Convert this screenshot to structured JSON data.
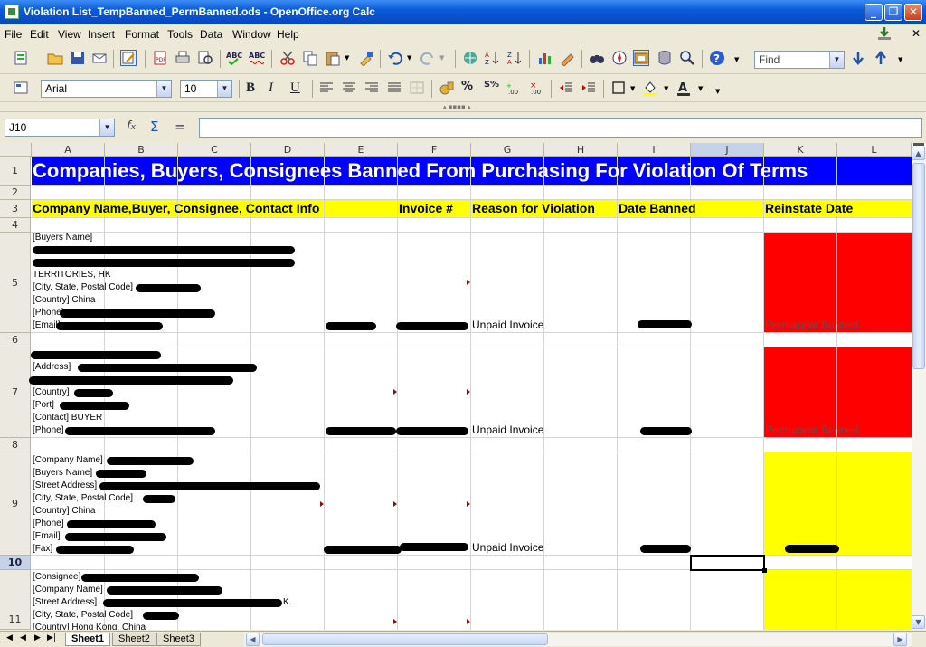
{
  "window": {
    "title": "Violation List_TempBanned_PermBanned.ods - OpenOffice.org Calc"
  },
  "menu": [
    "File",
    "Edit",
    "View",
    "Insert",
    "Format",
    "Tools",
    "Data",
    "Window",
    "Help"
  ],
  "toolbar": {
    "find_placeholder": "Find"
  },
  "format": {
    "font_name": "Arial",
    "font_size": "10"
  },
  "formula": {
    "cell_ref": "J10",
    "content": ""
  },
  "columns": [
    "A",
    "B",
    "C",
    "D",
    "E",
    "F",
    "G",
    "H",
    "I",
    "J",
    "K",
    "L"
  ],
  "rows": [
    "1",
    "2",
    "3",
    "4",
    "5",
    "6",
    "7",
    "8",
    "9",
    "10",
    "11"
  ],
  "sheet": {
    "title": "Companies, Buyers, Consignees Banned From Purchasing For Violation Of Terms",
    "headers": {
      "company": "Company Name,Buyer, Consignee, Contact Info",
      "invoice": "Invoice #",
      "reason": "Reason for Violation",
      "date_banned": "Date Banned",
      "reinstate": "Reinstate Date"
    },
    "row5": {
      "lines": [
        "[Buyers Name]",
        "",
        "",
        "TERRITORIES, HK",
        "[City, State, Postal Code]",
        "[Country] China",
        "[Phone]",
        "[Email]"
      ],
      "reason": "Unpaid Invoice",
      "status": "Permanent Banned"
    },
    "row7": {
      "lines": [
        "",
        "[Address]",
        "",
        "[Country]",
        "[Port]",
        "[Contact] BUYER",
        "[Phone]"
      ],
      "reason": "Unpaid Invoice",
      "status": "Permanent Banned"
    },
    "row9": {
      "lines": [
        "[Company Name]",
        "[Buyers Name]",
        "[Street Address]",
        "[City, State, Postal Code]",
        "[Country] China",
        "[Phone]",
        "[Email]",
        "[Fax]"
      ],
      "reason": "Unpaid Invoice"
    },
    "row11": {
      "lines": [
        "[Consignee]",
        "[Company Name]",
        "[Street Address]",
        "[City, State, Postal Code]",
        "[Country] Hong Kong, China"
      ],
      "fragment": "K."
    }
  },
  "tabs": [
    "Sheet1",
    "Sheet2",
    "Sheet3"
  ],
  "colors": {
    "title_bg": "#0000ff",
    "header_bg": "#ffff00",
    "perm_banned": "#ff0000",
    "temp_banned": "#ffff00"
  }
}
